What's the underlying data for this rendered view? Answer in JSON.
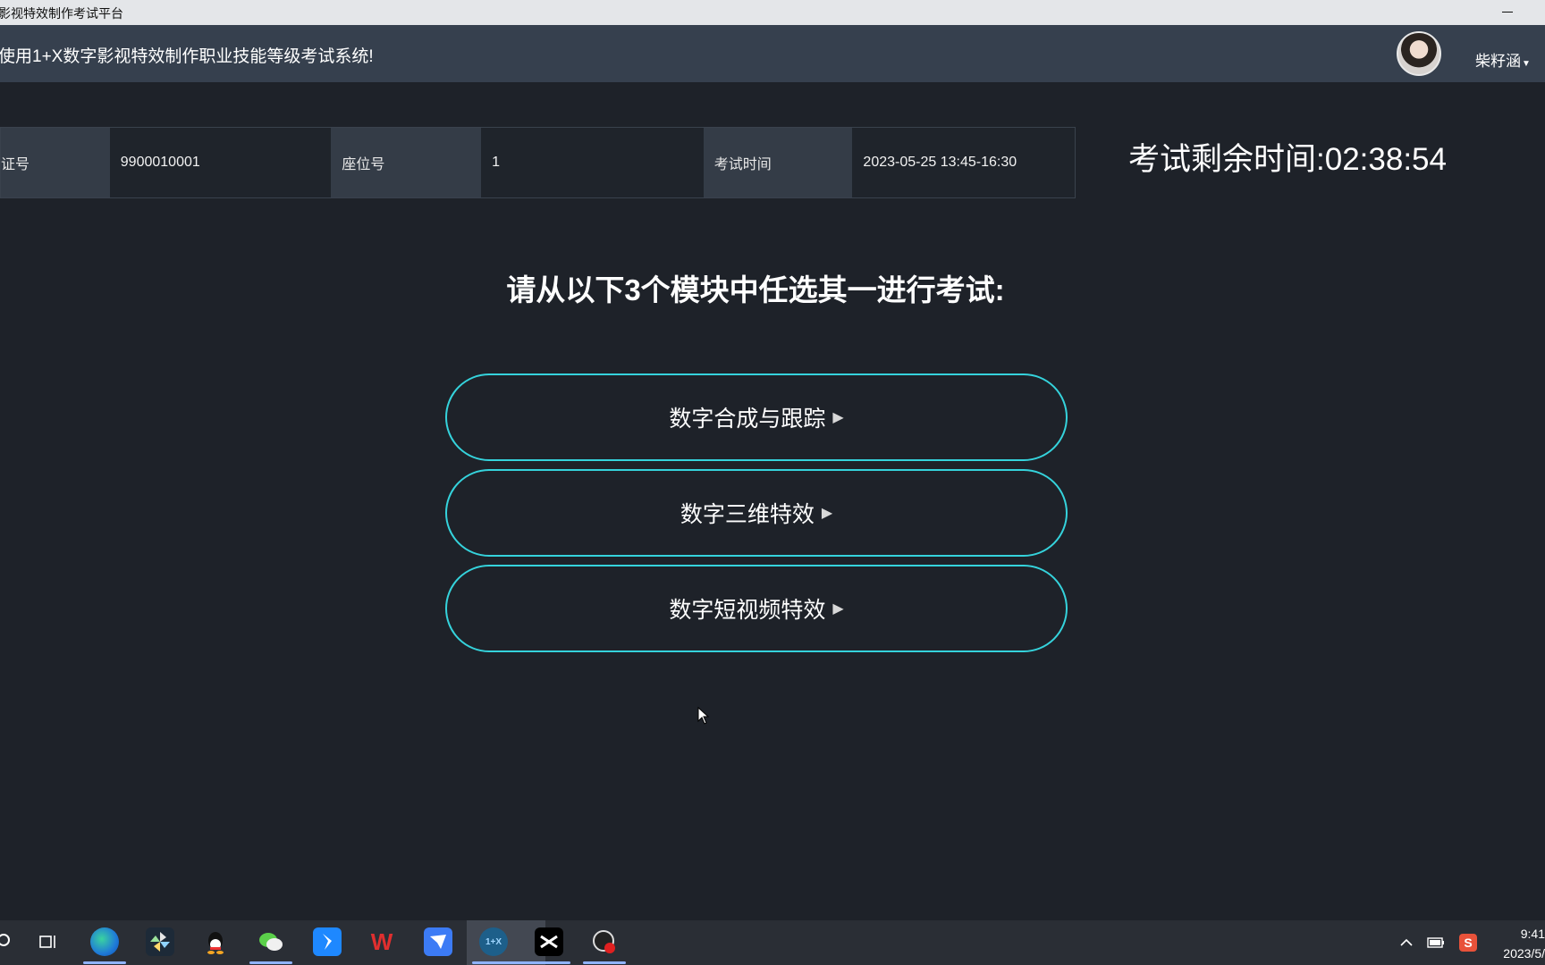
{
  "window": {
    "title": "影视特效制作考试平台"
  },
  "header": {
    "welcome_text": "使用1+X数字影视特效制作职业技能等级考试系统!",
    "username": "柴籽涵"
  },
  "exam_info": {
    "cert_label": "证号",
    "cert_value": "9900010001",
    "seat_label": "座位号",
    "seat_value": "1",
    "time_label": "考试时间",
    "time_value": "2023-05-25 13:45-16:30"
  },
  "timer": {
    "label": "考试剩余时间:",
    "value": "02:38:54"
  },
  "prompt": "请从以下3个模块中任选其一进行考试:",
  "modules": [
    {
      "label": "数字合成与跟踪"
    },
    {
      "label": "数字三维特效"
    },
    {
      "label": "数字短视频特效"
    }
  ],
  "taskbar": {
    "icons": [
      "search-icon",
      "task-view-icon",
      "edge-icon",
      "pinwheel-icon",
      "qq-icon",
      "wechat-icon",
      "feishu-icon",
      "wps-icon",
      "dingtalk-bird-icon",
      "exam-app-icon",
      "capcut-icon",
      "obs-icon"
    ],
    "clock_time": "9:41",
    "clock_date": "2023/5/"
  },
  "colors": {
    "accent": "#35d3dc",
    "header_bg": "#36404e",
    "page_bg": "#1e2229"
  }
}
